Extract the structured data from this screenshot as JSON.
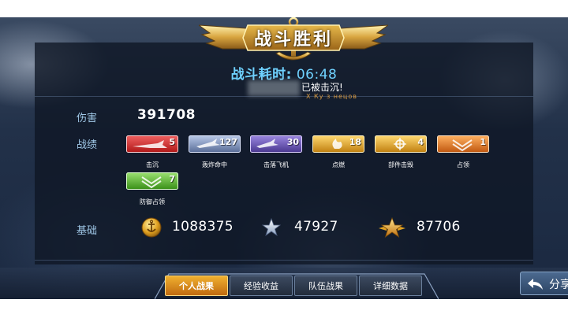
{
  "header": {
    "title": "战斗胜利",
    "battle_time_label": "战斗耗时:",
    "battle_time_value": "06:48",
    "sunk_message": "已被击沉!",
    "sunk_ship_name": "Х Ку з нецов"
  },
  "damage": {
    "label": "伤害",
    "value": "391708"
  },
  "record": {
    "label": "战绩",
    "medals": [
      {
        "caption": "击沉",
        "count": "5",
        "color": "#d83030"
      },
      {
        "caption": "轰炸命中",
        "count": "127",
        "color": "#7a8fb8"
      },
      {
        "caption": "击落飞机",
        "count": "30",
        "color": "#6a55b0"
      },
      {
        "caption": "点燃",
        "count": "18",
        "color": "#e0a020"
      },
      {
        "caption": "部件击毁",
        "count": "4",
        "color": "#e0a020"
      },
      {
        "caption": "占领",
        "count": "1",
        "color": "#e07020"
      },
      {
        "caption": "防御占领",
        "count": "7",
        "color": "#5cc030"
      }
    ]
  },
  "base": {
    "label": "基础",
    "coins": "1088375",
    "silver_star": "47927",
    "gold_star": "87706"
  },
  "tabs": [
    {
      "label": "个人战果",
      "active": true
    },
    {
      "label": "经验收益",
      "active": false
    },
    {
      "label": "队伍战果",
      "active": false
    },
    {
      "label": "详细数据",
      "active": false
    }
  ],
  "share": {
    "label": "分享"
  },
  "icons": {
    "coin": "anchor-coin-icon",
    "silver_star": "silver-star-icon",
    "gold_star": "gold-star-icon",
    "share": "share-arrow-icon"
  }
}
